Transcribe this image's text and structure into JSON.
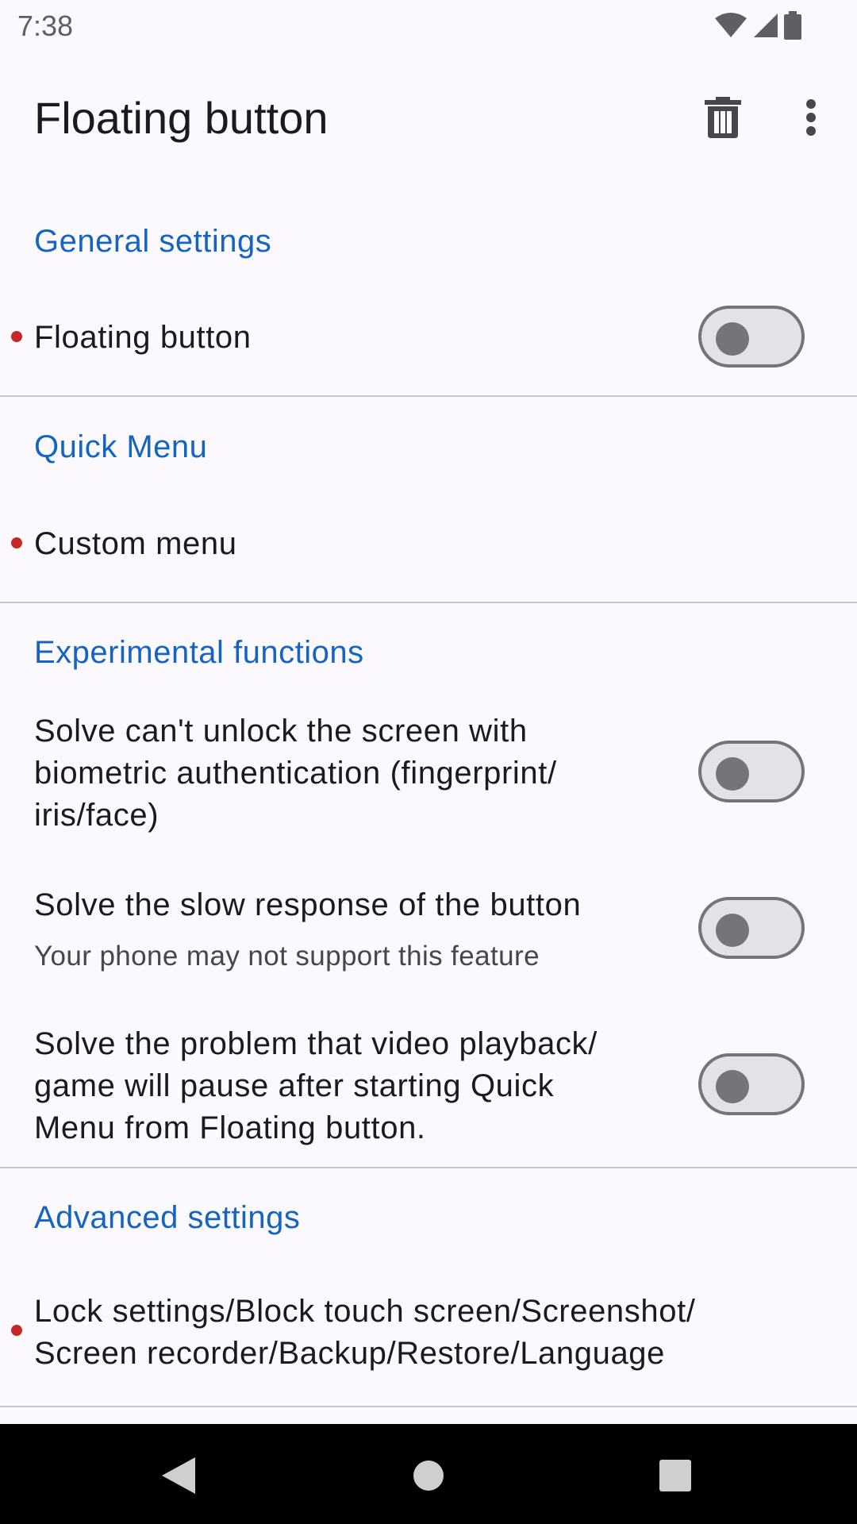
{
  "status_bar": {
    "time": "7:38",
    "icons": [
      "wifi-icon",
      "signal-icon",
      "battery-icon"
    ]
  },
  "app_bar": {
    "title": "Floating button",
    "actions": [
      "trash-icon",
      "more-vert-icon"
    ]
  },
  "sections": {
    "general": {
      "header": "General settings",
      "floating_button": {
        "title": "Floating button",
        "enabled": false
      }
    },
    "quick_menu": {
      "header": "Quick Menu",
      "custom_menu": {
        "title": "Custom menu"
      }
    },
    "experimental": {
      "header": "Experimental functions",
      "biometric": {
        "title_line1": "Solve can't unlock the screen with",
        "title_line2": "biometric authentication (fingerprint/",
        "title_line3": "iris/face)",
        "enabled": false
      },
      "slow_response": {
        "title": "Solve the slow response of the button",
        "summary": "Your phone may not support this feature",
        "enabled": false
      },
      "video_pause": {
        "title_line1": "Solve the problem that video playback/",
        "title_line2": "game will pause after starting Quick",
        "title_line3": "Menu from Floating button.",
        "enabled": false
      }
    },
    "advanced": {
      "header": "Advanced settings",
      "lock_settings": {
        "title_line1": "Lock settings/Block touch screen/Screenshot/",
        "title_line2": "Screen recorder/Backup/Restore/Language"
      }
    }
  },
  "nav_bar": {
    "buttons": [
      "back-icon",
      "home-icon",
      "recents-icon"
    ]
  },
  "colors": {
    "accent": "#1565c0",
    "indicator_dot": "#c62828",
    "background": "#fbf9fd"
  }
}
